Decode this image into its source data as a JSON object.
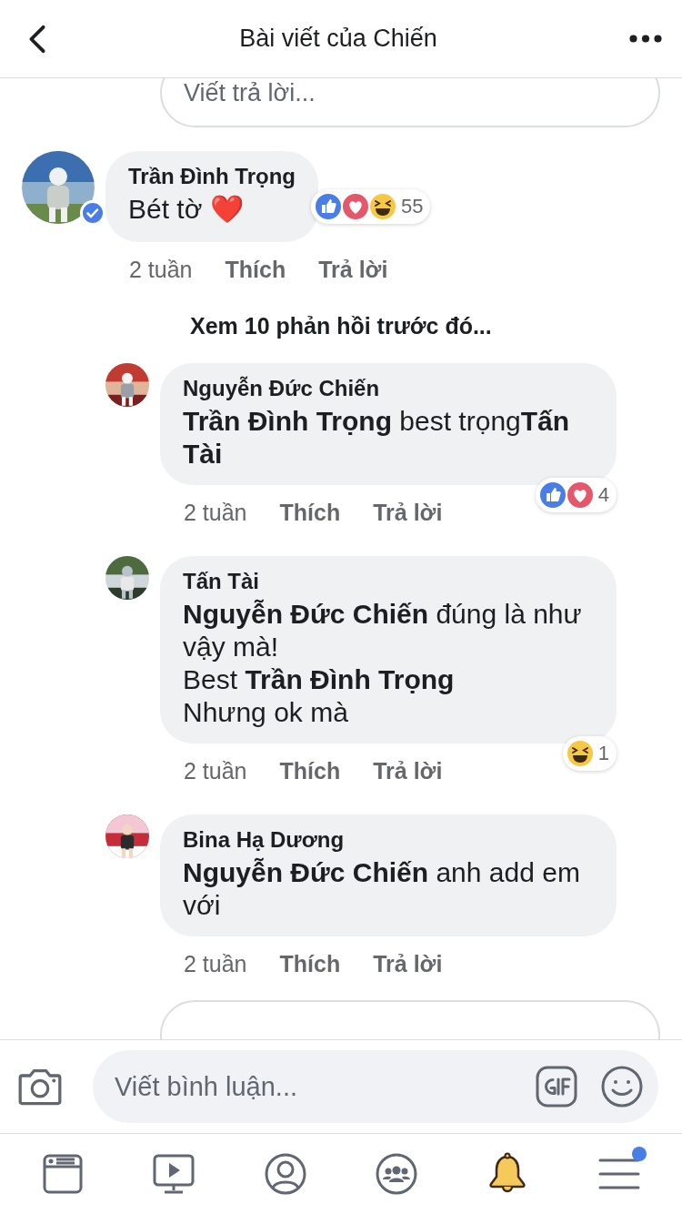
{
  "header": {
    "title": "Bài viết của Chiến"
  },
  "reply_field_top": {
    "placeholder": "Viết trả lời..."
  },
  "comment": {
    "author": "Trần Đình Trọng",
    "verified": true,
    "lines": [
      "Bét tờ ❤️"
    ],
    "reactions": {
      "types": [
        {
          "kind": "like"
        },
        {
          "kind": "love"
        },
        {
          "kind": "haha"
        }
      ],
      "count": "55"
    },
    "time": "2 tuần",
    "like": "Thích",
    "reply": "Trả lời",
    "more_replies": "Xem 10 phản hồi trước đó...",
    "replies": [
      {
        "author": "Nguyễn Đức Chiến",
        "verified": false,
        "lines": [
          "**Trần Đình Trọng** best trọng**Tấn Tài**"
        ],
        "reactions": {
          "types": [
            {
              "kind": "like"
            },
            {
              "kind": "love"
            }
          ],
          "count": "4"
        },
        "time": "2 tuần",
        "like": "Thích",
        "reply": "Trả lời"
      },
      {
        "author": "Tấn Tài",
        "verified": false,
        "lines": [
          "**Nguyễn Đức Chiến**  đúng là như vậy mà!",
          "Best **Trần Đình Trọng**",
          "Nhưng ok mà"
        ],
        "reactions": {
          "types": [
            {
              "kind": "haha"
            }
          ],
          "count": "1"
        },
        "time": "2 tuần",
        "like": "Thích",
        "reply": "Trả lời"
      },
      {
        "author": "Bina Hạ Dương",
        "verified": false,
        "lines": [
          "**Nguyễn Đức Chiến**  anh add em với"
        ],
        "time": "2 tuần",
        "like": "Thích",
        "reply": "Trả lời"
      }
    ]
  },
  "composer": {
    "placeholder": "Viết bình luận..."
  },
  "tabs": [
    {
      "kind": "feed",
      "selected": false,
      "badge": false
    },
    {
      "kind": "video",
      "selected": false,
      "badge": false
    },
    {
      "kind": "profile",
      "selected": false,
      "badge": false
    },
    {
      "kind": "groups",
      "selected": false,
      "badge": false
    },
    {
      "kind": "notifications",
      "selected": true,
      "badge": false
    },
    {
      "kind": "menu",
      "selected": false,
      "badge": true
    }
  ]
}
